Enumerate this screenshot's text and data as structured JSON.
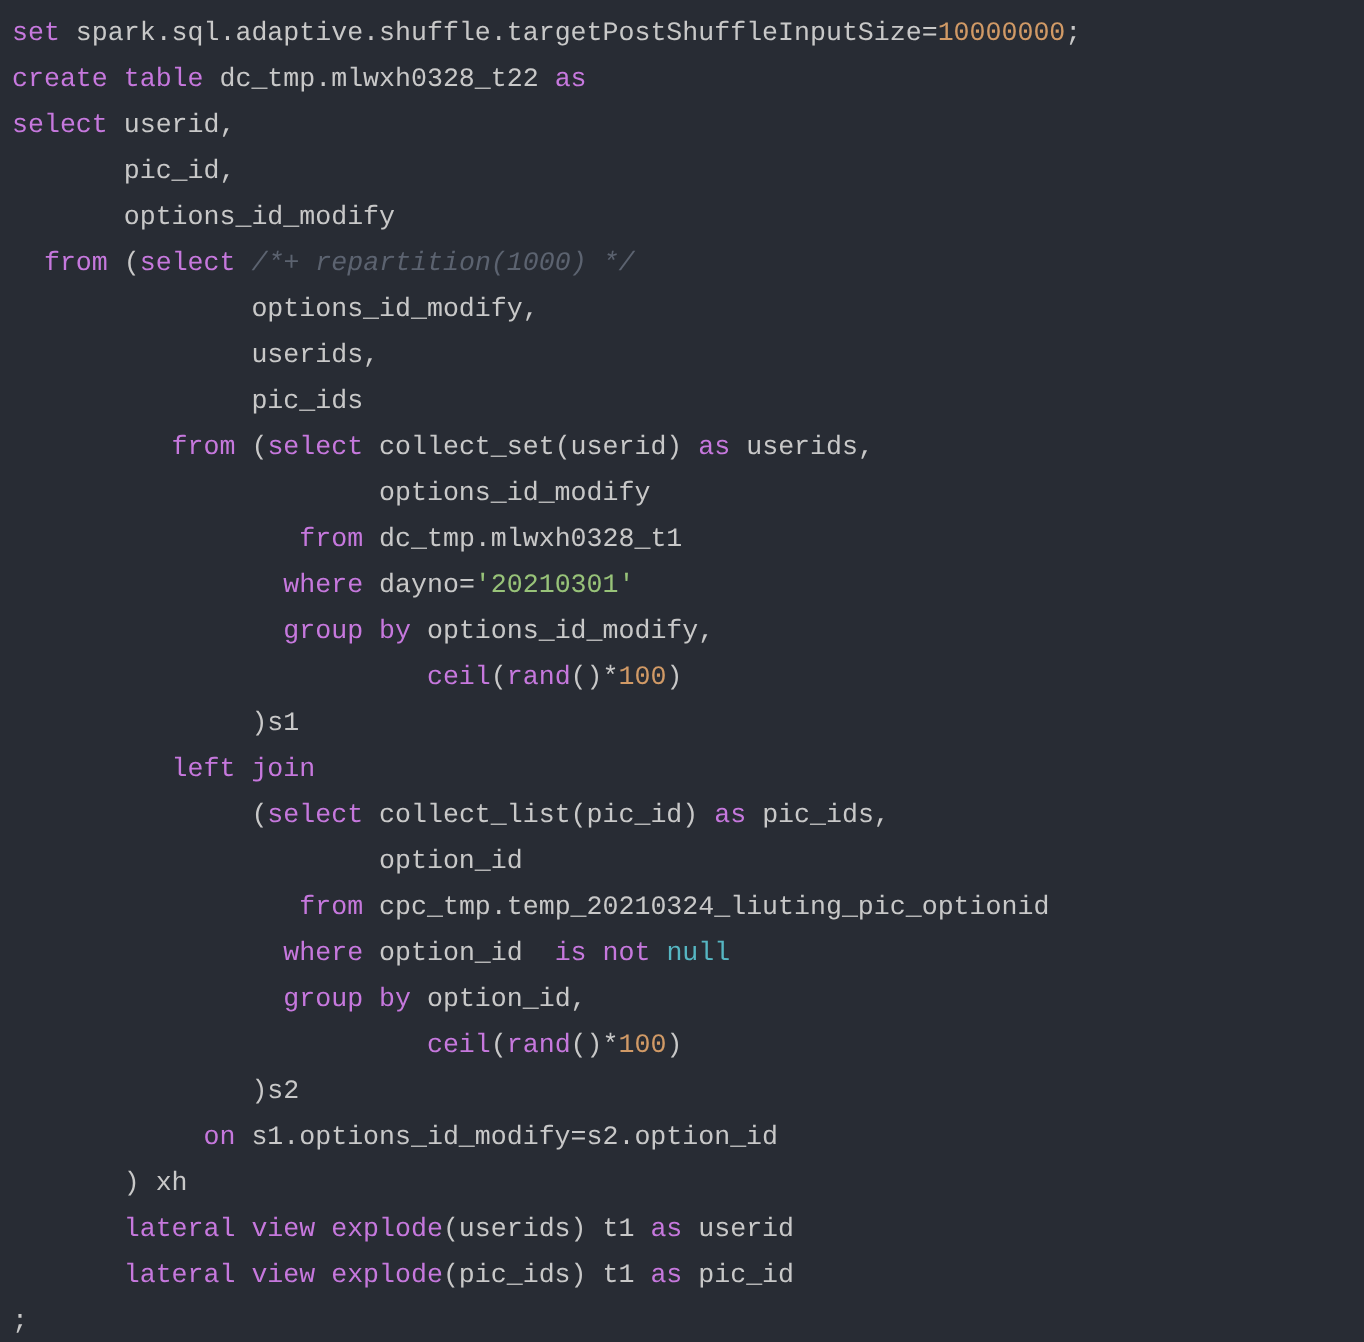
{
  "editor": {
    "lines": [
      {
        "tokens": [
          {
            "kind": "keyword",
            "text": "set"
          },
          {
            "kind": "plain",
            "text": " spark.sql.adaptive.shuffle.targetPostShuffleInputSize="
          },
          {
            "kind": "number",
            "text": "10000000"
          },
          {
            "kind": "plain",
            "text": ";"
          }
        ]
      },
      {
        "tokens": [
          {
            "kind": "keyword",
            "text": "create table"
          },
          {
            "kind": "plain",
            "text": " dc_tmp.mlwxh0328_t22 "
          },
          {
            "kind": "keyword",
            "text": "as"
          }
        ]
      },
      {
        "tokens": [
          {
            "kind": "keyword",
            "text": "select"
          },
          {
            "kind": "plain",
            "text": " userid,"
          }
        ]
      },
      {
        "tokens": [
          {
            "kind": "plain",
            "text": "       pic_id,"
          }
        ]
      },
      {
        "tokens": [
          {
            "kind": "plain",
            "text": "       options_id_modify"
          }
        ]
      },
      {
        "tokens": [
          {
            "kind": "keyword",
            "text": "  from"
          },
          {
            "kind": "plain",
            "text": " ("
          },
          {
            "kind": "keyword",
            "text": "select"
          },
          {
            "kind": "comment",
            "text": " /*+ repartition(1000) */"
          }
        ]
      },
      {
        "tokens": [
          {
            "kind": "plain",
            "text": "               options_id_modify,"
          }
        ]
      },
      {
        "tokens": [
          {
            "kind": "plain",
            "text": "               userids,"
          }
        ]
      },
      {
        "tokens": [
          {
            "kind": "plain",
            "text": "               pic_ids"
          }
        ]
      },
      {
        "tokens": [
          {
            "kind": "keyword",
            "text": "          from"
          },
          {
            "kind": "plain",
            "text": " ("
          },
          {
            "kind": "keyword",
            "text": "select"
          },
          {
            "kind": "plain",
            "text": " collect_set(userid) "
          },
          {
            "kind": "keyword",
            "text": "as"
          },
          {
            "kind": "plain",
            "text": " userids,"
          }
        ]
      },
      {
        "tokens": [
          {
            "kind": "plain",
            "text": "                       options_id_modify"
          }
        ]
      },
      {
        "tokens": [
          {
            "kind": "keyword",
            "text": "                  from"
          },
          {
            "kind": "plain",
            "text": " dc_tmp.mlwxh0328_t1"
          }
        ]
      },
      {
        "tokens": [
          {
            "kind": "keyword",
            "text": "                 where"
          },
          {
            "kind": "plain",
            "text": " dayno="
          },
          {
            "kind": "string",
            "text": "'20210301'"
          }
        ]
      },
      {
        "tokens": [
          {
            "kind": "keyword",
            "text": "                 group by"
          },
          {
            "kind": "plain",
            "text": " options_id_modify,"
          }
        ]
      },
      {
        "tokens": [
          {
            "kind": "keyword",
            "text": "                          ceil"
          },
          {
            "kind": "plain",
            "text": "("
          },
          {
            "kind": "keyword",
            "text": "rand"
          },
          {
            "kind": "plain",
            "text": "()*"
          },
          {
            "kind": "number",
            "text": "100"
          },
          {
            "kind": "plain",
            "text": ")"
          }
        ]
      },
      {
        "tokens": [
          {
            "kind": "plain",
            "text": "               )s1"
          }
        ]
      },
      {
        "tokens": [
          {
            "kind": "keyword",
            "text": "          left join"
          }
        ]
      },
      {
        "tokens": [
          {
            "kind": "plain",
            "text": "               ("
          },
          {
            "kind": "keyword",
            "text": "select"
          },
          {
            "kind": "plain",
            "text": " collect_list(pic_id) "
          },
          {
            "kind": "keyword",
            "text": "as"
          },
          {
            "kind": "plain",
            "text": " pic_ids,"
          }
        ]
      },
      {
        "tokens": [
          {
            "kind": "plain",
            "text": "                       option_id"
          }
        ]
      },
      {
        "tokens": [
          {
            "kind": "keyword",
            "text": "                  from"
          },
          {
            "kind": "plain",
            "text": " cpc_tmp.temp_20210324_liuting_pic_optionid"
          }
        ]
      },
      {
        "tokens": [
          {
            "kind": "keyword",
            "text": "                 where"
          },
          {
            "kind": "plain",
            "text": " option_id  "
          },
          {
            "kind": "keyword",
            "text": "is not"
          },
          {
            "kind": "constant",
            "text": " null"
          }
        ]
      },
      {
        "tokens": [
          {
            "kind": "keyword",
            "text": "                 group by"
          },
          {
            "kind": "plain",
            "text": " option_id,"
          }
        ]
      },
      {
        "tokens": [
          {
            "kind": "keyword",
            "text": "                          ceil"
          },
          {
            "kind": "plain",
            "text": "("
          },
          {
            "kind": "keyword",
            "text": "rand"
          },
          {
            "kind": "plain",
            "text": "()*"
          },
          {
            "kind": "number",
            "text": "100"
          },
          {
            "kind": "plain",
            "text": ")"
          }
        ]
      },
      {
        "tokens": [
          {
            "kind": "plain",
            "text": "               )s2"
          }
        ]
      },
      {
        "tokens": [
          {
            "kind": "keyword",
            "text": "            on"
          },
          {
            "kind": "plain",
            "text": " s1.options_id_modify=s2.option_id"
          }
        ]
      },
      {
        "tokens": [
          {
            "kind": "plain",
            "text": "       ) xh"
          }
        ]
      },
      {
        "tokens": [
          {
            "kind": "keyword",
            "text": "       lateral view explode"
          },
          {
            "kind": "plain",
            "text": "(userids) t1 "
          },
          {
            "kind": "keyword",
            "text": "as"
          },
          {
            "kind": "plain",
            "text": " userid"
          }
        ]
      },
      {
        "tokens": [
          {
            "kind": "keyword",
            "text": "       lateral view explode"
          },
          {
            "kind": "plain",
            "text": "(pic_ids) t1 "
          },
          {
            "kind": "keyword",
            "text": "as"
          },
          {
            "kind": "plain",
            "text": " pic_id"
          }
        ]
      },
      {
        "tokens": [
          {
            "kind": "plain",
            "text": ";"
          }
        ]
      }
    ]
  }
}
